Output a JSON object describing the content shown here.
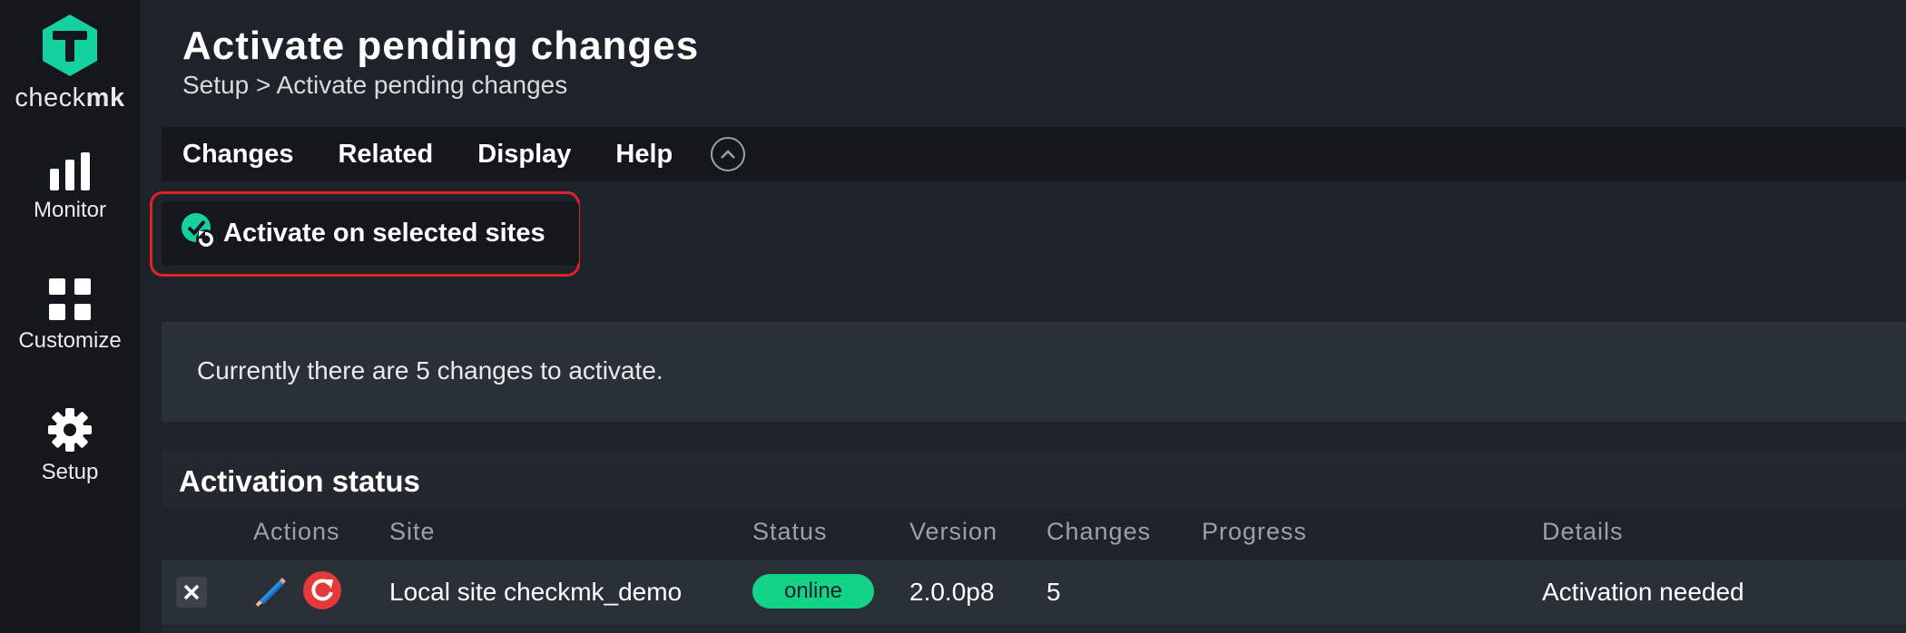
{
  "sidebar": {
    "logo_text_regular": "check",
    "logo_text_bold": "mk",
    "items": [
      {
        "label": "Monitor",
        "icon": "bar-chart-icon"
      },
      {
        "label": "Customize",
        "icon": "grid-icon"
      },
      {
        "label": "Setup",
        "icon": "gear-icon"
      }
    ]
  },
  "header": {
    "title": "Activate pending changes",
    "breadcrumb": {
      "parent": "Setup",
      "separator": ">",
      "current": "Activate pending changes"
    }
  },
  "menubar": {
    "items": [
      "Changes",
      "Related",
      "Display",
      "Help"
    ],
    "collapse_icon": "chevron-up-circle-icon"
  },
  "action": {
    "label": "Activate on selected sites",
    "icon": "activate-check-icon",
    "highlight_color": "#e0202a"
  },
  "info": {
    "message": "Currently there are 5 changes to activate."
  },
  "activation_status": {
    "title": "Activation status",
    "columns": [
      "Actions",
      "Site",
      "Status",
      "Version",
      "Changes",
      "Progress",
      "Details"
    ],
    "rows": [
      {
        "site": "Local site checkmk_demo",
        "status": "online",
        "version": "2.0.0p8",
        "changes": "5",
        "progress": "",
        "details": "Activation needed"
      }
    ]
  },
  "colors": {
    "brand": "#15d1a0",
    "status_online": "#13d389",
    "restart": "#e5393a"
  }
}
